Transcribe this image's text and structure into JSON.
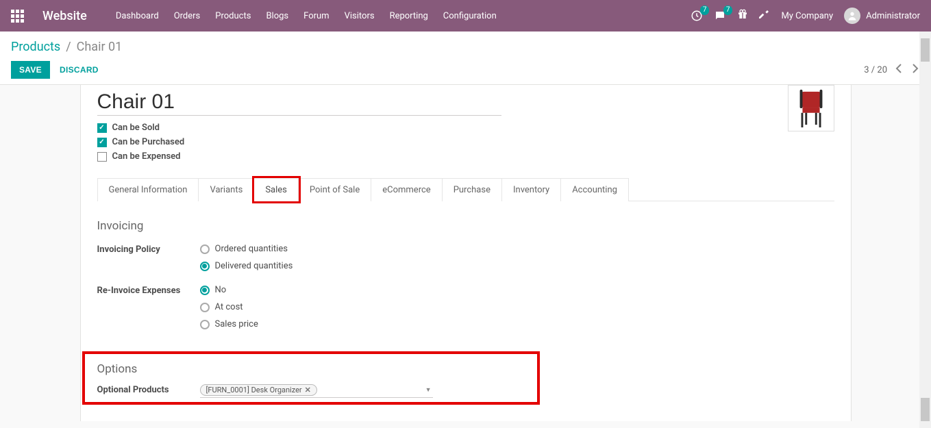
{
  "nav": {
    "brand": "Website",
    "links": [
      "Dashboard",
      "Orders",
      "Products",
      "Blogs",
      "Forum",
      "Visitors",
      "Reporting",
      "Configuration"
    ],
    "badge1": "7",
    "badge2": "7",
    "company": "My Company",
    "user": "Administrator"
  },
  "breadcrumb": {
    "root": "Products",
    "sep": "/",
    "current": "Chair 01"
  },
  "actions": {
    "save": "SAVE",
    "discard": "DISCARD"
  },
  "pager": {
    "text": "3 / 20"
  },
  "form": {
    "title": "Chair 01",
    "checks": {
      "sold": {
        "label": "Can be Sold",
        "checked": true
      },
      "purchased": {
        "label": "Can be Purchased",
        "checked": true
      },
      "expensed": {
        "label": "Can be Expensed",
        "checked": false
      }
    },
    "tabs": [
      "General Information",
      "Variants",
      "Sales",
      "Point of Sale",
      "eCommerce",
      "Purchase",
      "Inventory",
      "Accounting"
    ],
    "active_tab": "Sales",
    "sections": {
      "invoicing": {
        "title": "Invoicing",
        "policy": {
          "label": "Invoicing Policy",
          "options": [
            "Ordered quantities",
            "Delivered quantities"
          ],
          "selected": "Delivered quantities"
        },
        "reinvoice": {
          "label": "Re-Invoice Expenses",
          "options": [
            "No",
            "At cost",
            "Sales price"
          ],
          "selected": "No"
        }
      },
      "options": {
        "title": "Options",
        "optional_products": {
          "label": "Optional Products",
          "tag": "[FURN_0001] Desk Organizer"
        }
      }
    }
  }
}
